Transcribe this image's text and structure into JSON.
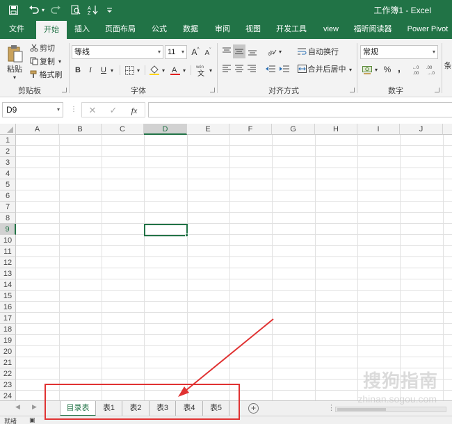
{
  "titlebar": {
    "title": "工作簿1  -  Excel",
    "save_icon": "save-icon",
    "undo_icon": "undo-icon",
    "redo_icon": "redo-icon",
    "print_preview_icon": "print-preview-icon",
    "sort_icon": "sort-icon",
    "customize_icon": "customize-qat-icon"
  },
  "tabs": [
    {
      "label": "文件"
    },
    {
      "label": "开始"
    },
    {
      "label": "插入"
    },
    {
      "label": "页面布局"
    },
    {
      "label": "公式"
    },
    {
      "label": "数据"
    },
    {
      "label": "审阅"
    },
    {
      "label": "视图"
    },
    {
      "label": "开发工具"
    },
    {
      "label": "view"
    },
    {
      "label": "福昕阅读器"
    },
    {
      "label": "Power Pivot"
    }
  ],
  "ribbon": {
    "clipboard": {
      "paste": "粘贴",
      "cut": "剪切",
      "copy": "复制",
      "format_painter": "格式刷",
      "group_label": "剪贴板"
    },
    "font": {
      "font_name": "等线",
      "font_size": "11",
      "grow": "A",
      "shrink": "A",
      "bold": "B",
      "italic": "I",
      "underline": "U",
      "group_label": "字体"
    },
    "alignment": {
      "wrap_text": "自动换行",
      "merge_center": "合并后居中",
      "group_label": "对齐方式"
    },
    "number": {
      "format": "常规",
      "percent": "%",
      "comma": ",",
      "group_label": "数字"
    },
    "more": "条"
  },
  "formulabar": {
    "namebox": "D9",
    "cancel_icon": "cancel-icon",
    "confirm_icon": "confirm-icon",
    "fx": "fx",
    "value": ""
  },
  "grid": {
    "columns": [
      "A",
      "B",
      "C",
      "D",
      "E",
      "F",
      "G",
      "H",
      "I",
      "J"
    ],
    "rows": [
      "1",
      "2",
      "3",
      "4",
      "5",
      "6",
      "7",
      "8",
      "9",
      "10",
      "11",
      "12",
      "13",
      "14",
      "15",
      "16",
      "17",
      "18",
      "19",
      "20",
      "21",
      "22",
      "23",
      "24"
    ],
    "selected_column": "D",
    "selected_row": "9"
  },
  "sheets": {
    "tabs": [
      {
        "label": "目录表",
        "active": true
      },
      {
        "label": "表1"
      },
      {
        "label": "表2"
      },
      {
        "label": "表3"
      },
      {
        "label": "表4"
      },
      {
        "label": "表5"
      }
    ],
    "add": "+"
  },
  "statusbar": {
    "ready": "就绪"
  },
  "watermark": {
    "text": "搜狗指南",
    "url": "zhinan.sogou.com"
  },
  "annotation": {
    "color": "#e03232"
  },
  "colors": {
    "accent": "#217346",
    "annotation": "#e03232"
  }
}
